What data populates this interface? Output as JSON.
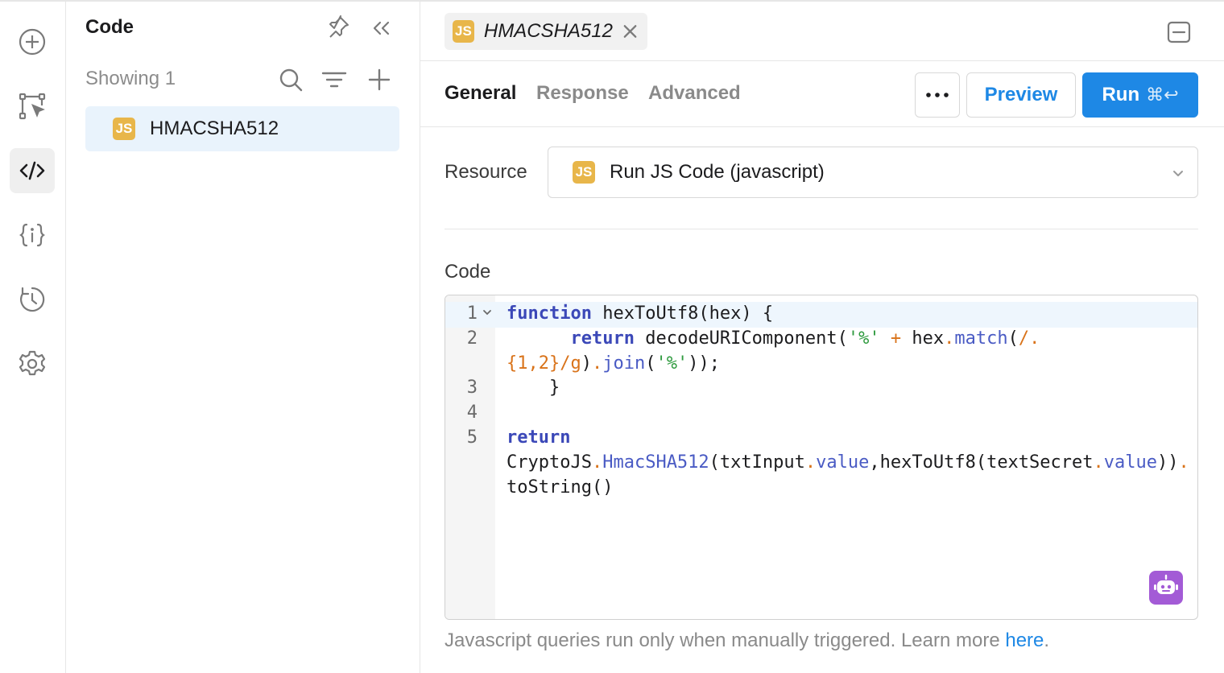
{
  "rail": {
    "items": [
      {
        "name": "add-icon"
      },
      {
        "name": "workflow-icon"
      },
      {
        "name": "code-icon",
        "active": true
      },
      {
        "name": "variables-icon"
      },
      {
        "name": "history-icon"
      },
      {
        "name": "settings-icon"
      }
    ]
  },
  "panel": {
    "title": "Code",
    "showing": "Showing 1",
    "items": [
      {
        "badge": "JS",
        "label": "HMACSHA512"
      }
    ]
  },
  "tab": {
    "badge": "JS",
    "name": "HMACSHA512"
  },
  "subtabs": {
    "general": "General",
    "response": "Response",
    "advanced": "Advanced"
  },
  "actions": {
    "more": "•••",
    "preview": "Preview",
    "run": "Run",
    "run_shortcut": "⌘↩"
  },
  "resource": {
    "label": "Resource",
    "badge": "JS",
    "value": "Run JS Code (javascript)"
  },
  "code": {
    "label": "Code",
    "line_numbers": [
      "1",
      "2",
      "3",
      "4",
      "5"
    ],
    "lines": [
      "function hexToUtf8(hex) {",
      "      return decodeURIComponent('%' + hex.match(/.",
      "{1,2}/g).join('%'));",
      "    }",
      "",
      "return",
      "CryptoJS.HmacSHA512(txtInput.value,hexToUtf8(textSecret.value)).",
      "toString()"
    ]
  },
  "hint": {
    "text": "Javascript queries run only when manually triggered. Learn more ",
    "link": "here",
    "suffix": "."
  },
  "colors": {
    "accent": "#1e88e5",
    "js_badge": "#e8b64a",
    "keyword": "#3b48b8",
    "string": "#2e9a3e",
    "operator": "#d9731a",
    "assistant": "#a35bd6"
  }
}
